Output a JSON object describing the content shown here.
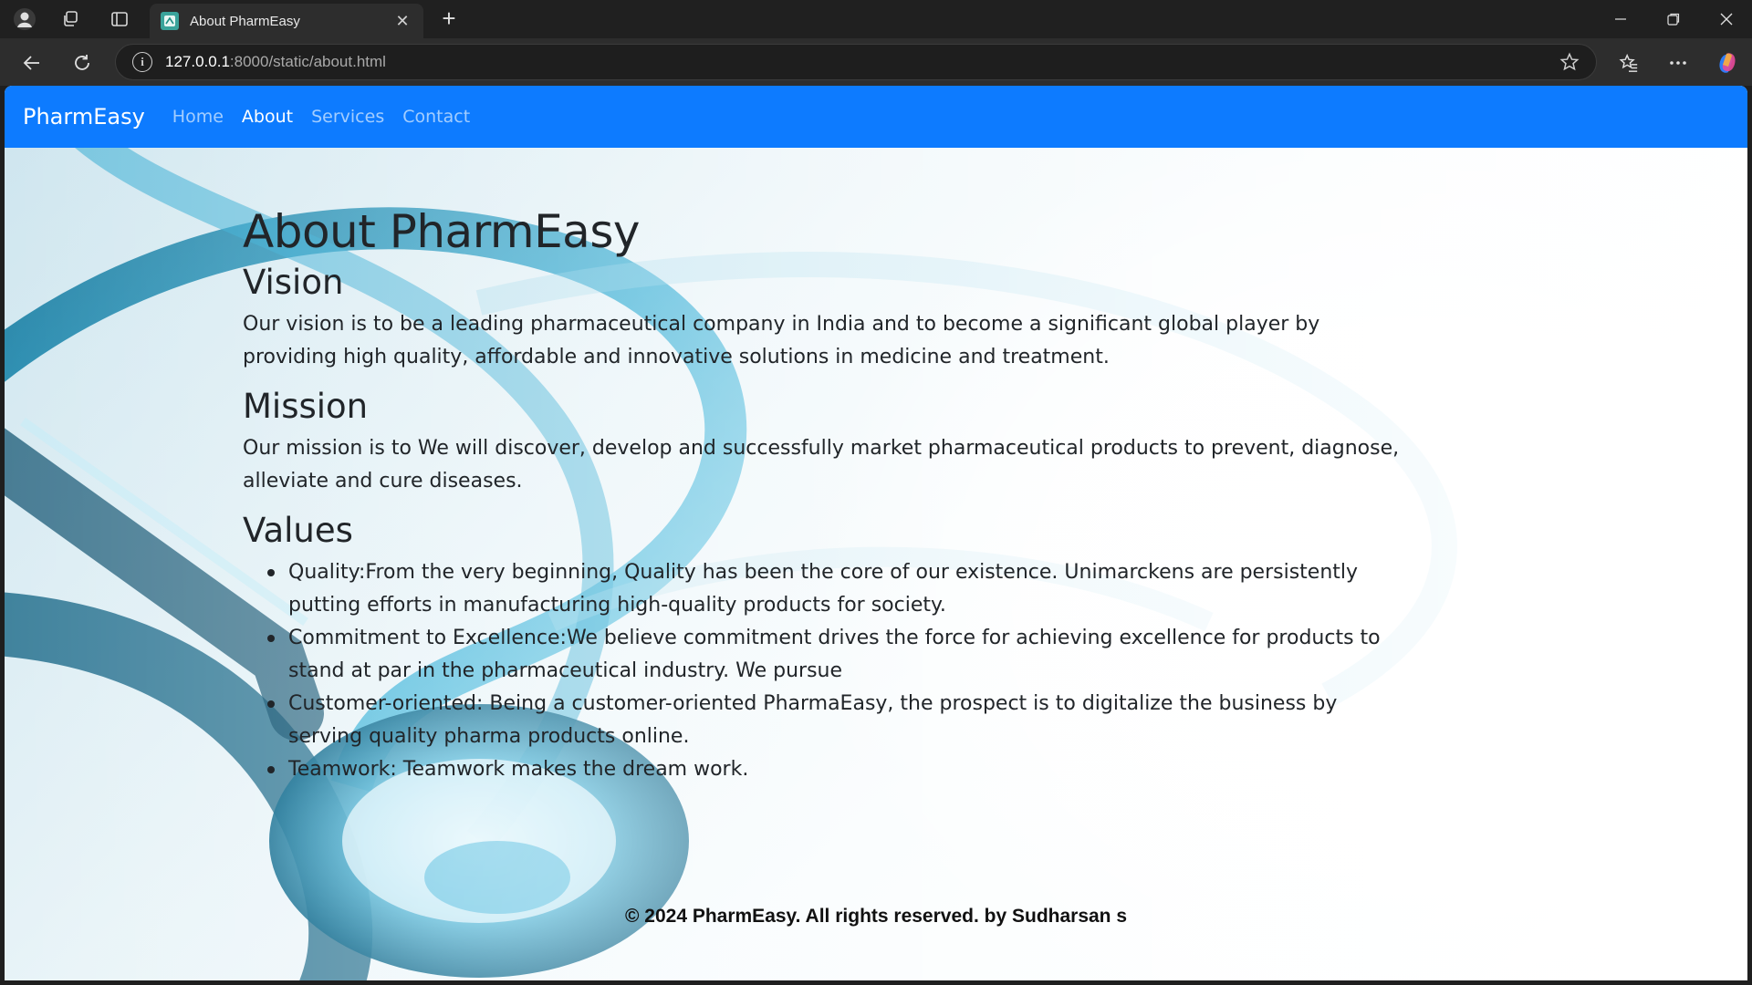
{
  "browser": {
    "tab_title": "About PharmEasy",
    "url_host": "127.0.0.1",
    "url_path": ":8000/static/about.html",
    "tab_close_glyph": "✕",
    "new_tab_glyph": "+"
  },
  "navbar": {
    "brand": "PharmEasy",
    "links": [
      "Home",
      "About",
      "Services",
      "Contact"
    ],
    "active_link": "About",
    "color": "#0d7bff"
  },
  "page": {
    "title": "About PharmEasy",
    "vision": {
      "heading": "Vision",
      "text": "Our vision is to be a leading pharmaceutical company in India and to become a significant global player by providing high quality, affordable and innovative solutions in medicine and treatment."
    },
    "mission": {
      "heading": "Mission",
      "text": "Our mission is to We will discover, develop and successfully market pharmaceutical products to prevent, diagnose, alleviate and cure diseases."
    },
    "values": {
      "heading": "Values",
      "items": [
        "Quality:From the very beginning, Quality has been the core of our existence. Unimarckens are persistently putting efforts in manufacturing high-quality products for society.",
        "Commitment to Excellence:We believe commitment drives the force for achieving excellence for products to stand at par in the pharmaceutical industry. We pursue",
        "Customer-oriented: Being a customer-oriented PharmaEasy, the prospect is to digitalize the business by serving quality pharma products online.",
        "Teamwork: Teamwork makes the dream work."
      ]
    },
    "footer": "© 2024 PharmEasy. All rights reserved. by Sudharsan s"
  }
}
